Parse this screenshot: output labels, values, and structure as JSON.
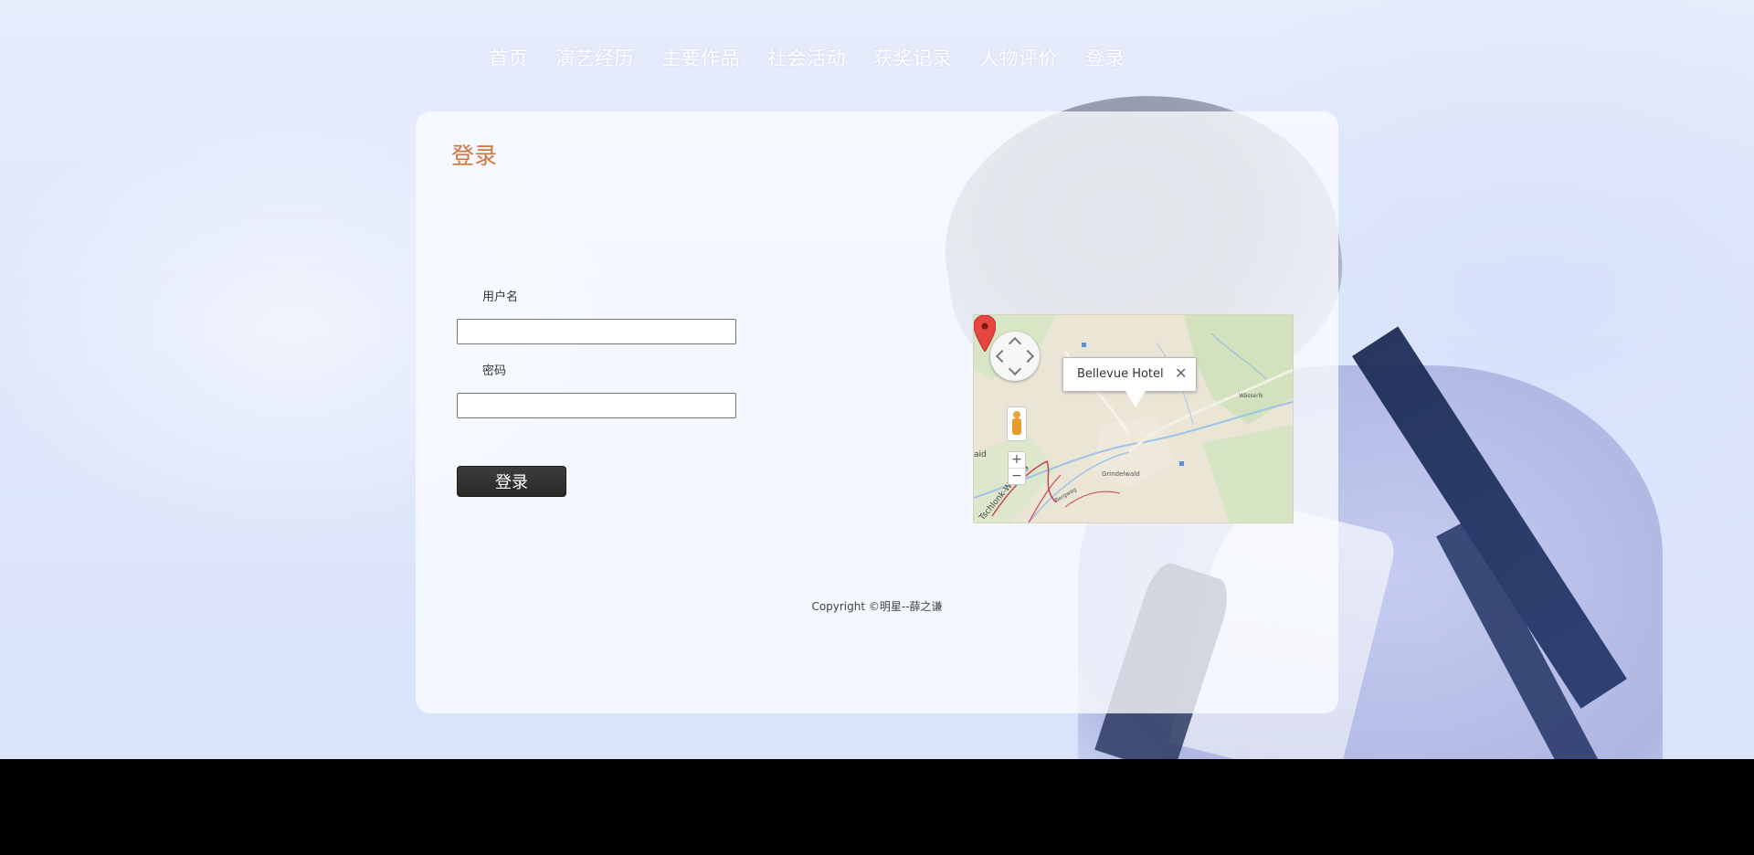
{
  "nav": {
    "items": [
      "首页",
      "演艺经历",
      "主要作品",
      "社会活动",
      "获奖记录",
      "人物评价",
      "登录"
    ]
  },
  "login": {
    "title": "登录",
    "username_label": "用户名",
    "username_value": "",
    "password_label": "密码",
    "password_value": "",
    "submit_label": "登录"
  },
  "map": {
    "infowindow_text": "Bellevue Hotel",
    "close_glyph": "✕",
    "zoom_in": "+",
    "zoom_out": "−",
    "labels": [
      "Grindelwald",
      "aid",
      "Tschlonk-Wallegg",
      "Wässerlk",
      "Bergweg"
    ]
  },
  "footer": {
    "copyright": "Copyright ©明星--薛之谦"
  },
  "colors": {
    "title_accent": "#d3743f",
    "button_bg": "#333333",
    "footer_bg": "#000000"
  }
}
